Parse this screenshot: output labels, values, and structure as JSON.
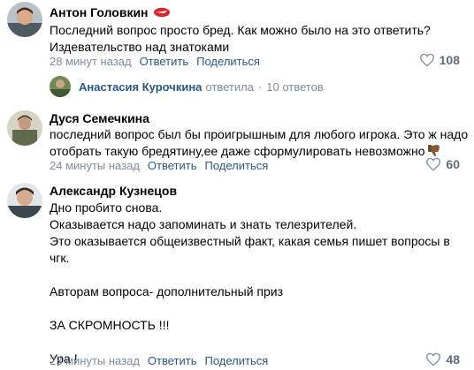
{
  "comments": [
    {
      "author": "Антон Головкин",
      "text": "Последний вопрос просто бред. Как можно было на это ответить?\nИздевательство над знатоками",
      "time": "28 минут назад",
      "reply_label": "Ответить",
      "share_label": "Поделиться",
      "likes": "108"
    },
    {
      "author": "Дуся Семечкина",
      "text": "последний вопрос был бы проигрышным для любого игрока. Это ж надо\nотобрать такую бредятину,ее даже сформулировать невозможно",
      "time": "24 минуты назад",
      "reply_label": "Ответить",
      "share_label": "Поделиться",
      "likes": "60"
    },
    {
      "author": "Александр Кузнецов",
      "text": "Дно пробито снова.\nОказывается надо запоминать и знать телезрителей.\nЭто оказывается общеизвестный факт, какая семья пишет вопросы в\nчгк.\n\nАвторам вопроса- дополнительный приз\n\nЗА СКРОМНОСТЬ !!!\n\nУра !",
      "time": "23 минуты назад",
      "reply_label": "Ответить",
      "share_label": "Поделиться",
      "likes": "48"
    }
  ],
  "reply_thread": {
    "author": "Анастасия Курочкина",
    "action": "ответила",
    "count_label": "10 ответов"
  },
  "colors": {
    "link": "#2a5885",
    "muted": "#818c99",
    "likes": "#626d7a",
    "badge": "#d7262e"
  },
  "icons": {
    "like": "heart-outline-icon",
    "badge": "spartak-badge-icon",
    "emoji": "thumbs-down-emoji"
  }
}
